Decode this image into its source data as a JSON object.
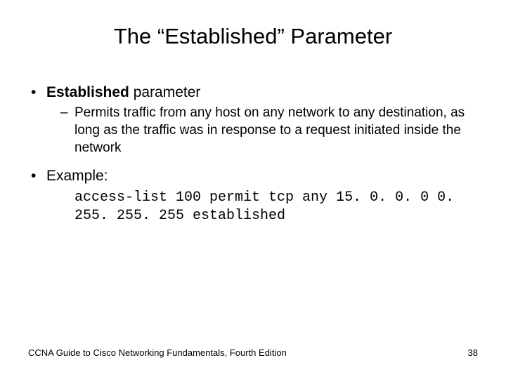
{
  "title": "The “Established” Parameter",
  "bullets": {
    "b1_bold": "Established",
    "b1_rest": " parameter",
    "b1_sub": "Permits traffic from any host on any network to any destination, as long as the traffic was in response to a request initiated inside the network",
    "b2": "Example:",
    "code": "access-list 100 permit tcp any 15. 0. 0. 0 0. 255. 255. 255 established"
  },
  "footer": {
    "left": "CCNA Guide to Cisco Networking Fundamentals, Fourth Edition",
    "right": "38"
  }
}
